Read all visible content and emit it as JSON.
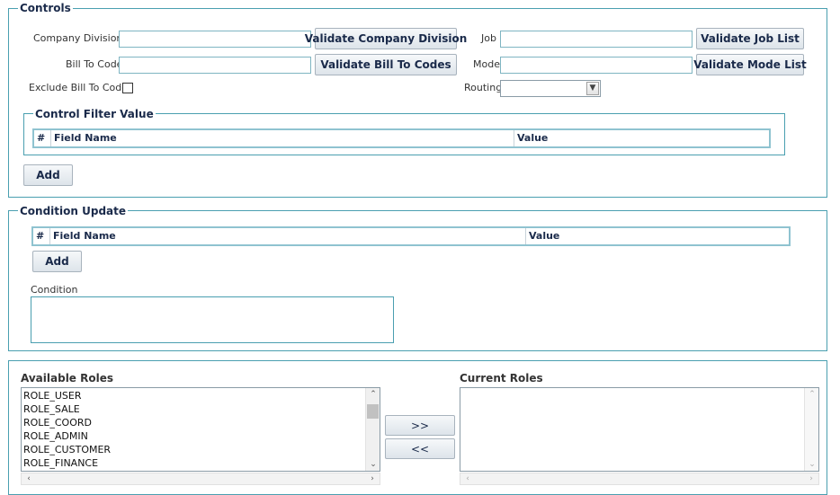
{
  "controls": {
    "legend": "Controls",
    "company_divisions_label": "Company Divisions",
    "company_divisions_value": "",
    "validate_company_division_label": "Validate Company Division",
    "bill_to_code_label": "Bill To Code",
    "bill_to_code_value": "",
    "validate_bill_to_codes_label": "Validate Bill To Codes",
    "exclude_bill_to_code_label": "Exclude Bill To Code",
    "exclude_bill_to_code_checked": false,
    "job_label": "Job",
    "job_value": "",
    "validate_job_list_label": "Validate Job List",
    "mode_label": "Mode",
    "mode_value": "",
    "validate_mode_list_label": "Validate Mode List",
    "routing_label": "Routing",
    "routing_selected": ""
  },
  "control_filter": {
    "legend": "Control Filter Value",
    "columns": [
      "#",
      "Field Name",
      "Value"
    ],
    "add_label": "Add"
  },
  "condition_update": {
    "legend": "Condition Update",
    "columns": [
      "#",
      "Field Name",
      "Value"
    ],
    "add_label": "Add",
    "condition_label": "Condition",
    "condition_value": ""
  },
  "roles": {
    "available_header": "Available Roles",
    "current_header": "Current Roles",
    "available": [
      "ROLE_USER",
      "ROLE_SALE",
      "ROLE_COORD",
      "ROLE_ADMIN",
      "ROLE_CUSTOMER",
      "ROLE_FINANCE"
    ],
    "current": [],
    "add_button": ">>",
    "remove_button": "<<"
  },
  "colors": {
    "border_accent": "#4a9fb0",
    "legend_text": "#1a2a4a"
  }
}
